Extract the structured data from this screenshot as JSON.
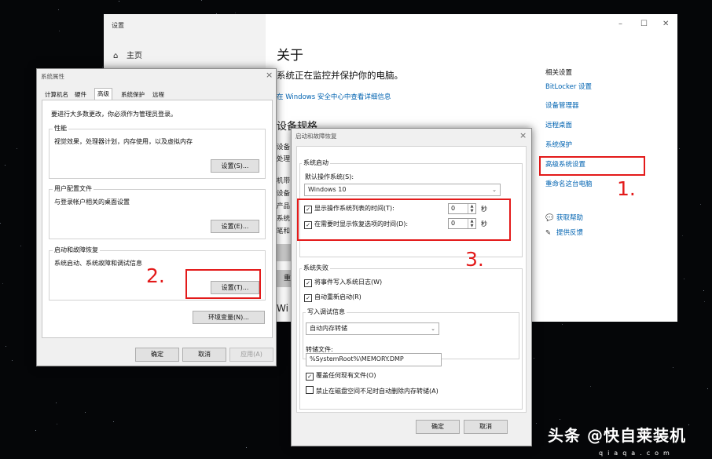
{
  "settings": {
    "title": "设置",
    "home": "主页",
    "about": "关于",
    "protected": "系统正在监控并保护你的电脑。",
    "security_link": "在 Windows 安全中心中查看详细信息",
    "device_specs": "设备规格",
    "spec_labels": [
      "设备",
      "处理",
      "机带",
      "设备",
      "产品",
      "系统",
      "笔和"
    ],
    "button_fragment": "重",
    "win_fragment": "Wi",
    "related_title": "相关设置",
    "related_links": [
      "BitLocker 设置",
      "设备管理器",
      "远程桌面",
      "系统保护",
      "高级系统设置",
      "重命名这台电脑"
    ],
    "help": [
      "获取帮助",
      "提供反馈"
    ],
    "win_controls": [
      "–",
      "☐",
      "✕"
    ]
  },
  "sysprops": {
    "title": "系统属性",
    "tabs": [
      "计算机名",
      "硬件",
      "高级",
      "系统保护",
      "远程"
    ],
    "admin_note": "要进行大多数更改，你必须作为管理员登录。",
    "performance": {
      "label": "性能",
      "desc": "视觉效果，处理器计划，内存使用，以及虚拟内存",
      "button": "设置(S)..."
    },
    "profiles": {
      "label": "用户配置文件",
      "desc": "与登录帐户相关的桌面设置",
      "button": "设置(E)..."
    },
    "startup": {
      "label": "启动和故障恢复",
      "desc": "系统启动、系统故障和调试信息",
      "button": "设置(T)..."
    },
    "env_button": "环境变量(N)...",
    "ok": "确定",
    "cancel": "取消",
    "apply": "应用(A)"
  },
  "startup": {
    "title": "启动和故障恢复",
    "boot_group": "系统启动",
    "default_os_label": "默认操作系统(S):",
    "default_os": "Windows 10",
    "show_list": "显示操作系统列表的时间(T):",
    "show_list_value": "0",
    "show_recovery": "在需要时显示恢复选项的时间(D):",
    "show_recovery_value": "0",
    "unit": "秒",
    "failure_group": "系统失败",
    "write_event": "将事件写入系统日志(W)",
    "auto_restart": "自动重新启动(R)",
    "debug_label": "写入调试信息",
    "debug_type": "自动内存转储",
    "dump_file_label": "转储文件:",
    "dump_file": "%SystemRoot%\\MEMORY.DMP",
    "overwrite": "覆盖任何现有文件(O)",
    "disable_auto_delete": "禁止在磁盘空间不足时自动删除内存转储(A)",
    "ok": "确定",
    "cancel": "取消"
  },
  "annotations": [
    "1.",
    "2.",
    "3."
  ],
  "watermark": {
    "main": "头条 @快自莱装机",
    "sub": "qiaqa.com"
  }
}
